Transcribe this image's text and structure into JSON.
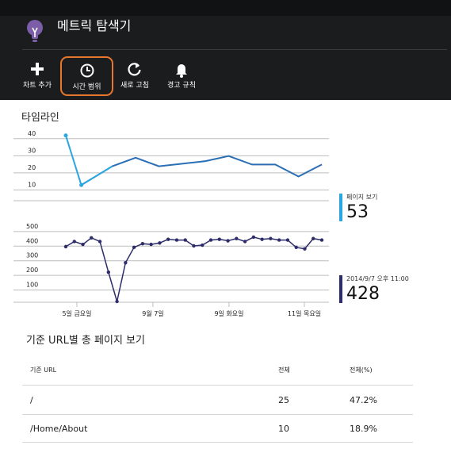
{
  "app": {
    "title": "메트릭 탐색기",
    "icon": "lightbulb-icon",
    "accent": "#7b5ea7"
  },
  "toolbar": {
    "items": [
      {
        "label": "차트 추가",
        "icon": "plus-icon"
      },
      {
        "label": "시간 범위",
        "icon": "clock-icon",
        "highlighted": true,
        "highlight_color": "#e8772e"
      },
      {
        "label": "새로 고침",
        "icon": "refresh-icon"
      },
      {
        "label": "경고 규칙",
        "icon": "bell-icon"
      }
    ]
  },
  "timeline": {
    "title": "타임라인",
    "x_ticks": [
      "5일 금요일",
      "9월 7일",
      "9일 화요일",
      "11일 목요일"
    ],
    "legend": [
      {
        "name": "페이지 보기",
        "value": "53",
        "color": "#2aa7e0"
      },
      {
        "name": "2014/9/7 오후 11:00",
        "value": "428",
        "color": "#2e2d6b"
      }
    ]
  },
  "chart_data": [
    {
      "type": "line",
      "ylim": [
        0,
        45
      ],
      "y_ticks": [
        "40",
        "30",
        "20",
        "10"
      ],
      "y_tick_values": [
        40,
        30,
        20,
        10
      ],
      "series": [
        {
          "name": "페이지 보기",
          "color": "#2a6fb5",
          "highlight_color": "#2aa7e0",
          "x": [
            0,
            2,
            6,
            9,
            12,
            15,
            18,
            21,
            24,
            27,
            30,
            33
          ],
          "values": [
            40,
            11,
            22,
            27,
            22,
            23.5,
            25,
            28,
            23,
            23,
            16,
            23
          ]
        }
      ]
    },
    {
      "type": "line",
      "ylim": [
        0,
        510
      ],
      "y_ticks": [
        "500",
        "400",
        "300",
        "200",
        "100"
      ],
      "y_tick_values": [
        500,
        400,
        300,
        200,
        100
      ],
      "series": [
        {
          "name": "2014/9/7 오후 11:00",
          "color": "#2e2d6b",
          "x": [
            0,
            1,
            2,
            3,
            4,
            5,
            6,
            7,
            8,
            9,
            10,
            11,
            12,
            13,
            14,
            15,
            16,
            17,
            18,
            19,
            20,
            21,
            22,
            23,
            24,
            25,
            26,
            27,
            28,
            29,
            30
          ],
          "values": [
            375,
            410,
            390,
            435,
            410,
            200,
            0,
            265,
            370,
            395,
            390,
            400,
            425,
            420,
            420,
            380,
            385,
            420,
            425,
            415,
            430,
            410,
            440,
            425,
            430,
            420,
            420,
            370,
            360,
            430,
            420
          ]
        }
      ]
    }
  ],
  "url_table": {
    "title": "기준 URL별 총 페이지 보기",
    "headers": [
      "기준 URL",
      "전체",
      "전체(%)"
    ],
    "rows": [
      [
        "/",
        "25",
        "47.2%"
      ],
      [
        "/Home/About",
        "10",
        "18.9%"
      ]
    ]
  }
}
